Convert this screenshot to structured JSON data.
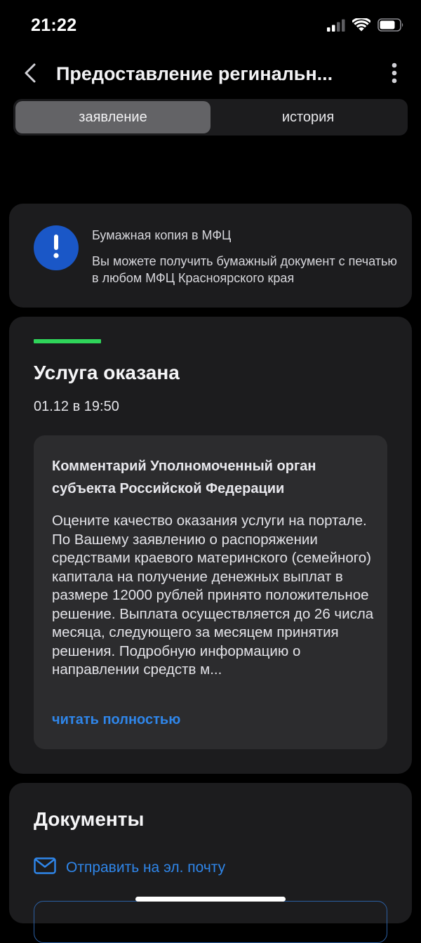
{
  "status_bar": {
    "time": "21:22"
  },
  "nav": {
    "title": "Предоставление регинальн...",
    "back_icon": "chevron-left-icon",
    "more_icon": "vertical-dots-icon"
  },
  "tabs": [
    {
      "label": "заявление",
      "active": true
    },
    {
      "label": "история",
      "active": false
    }
  ],
  "info_card": {
    "icon": "exclamation-icon",
    "title": "Бумажная копия в МФЦ",
    "text": "Вы можете получить бумажный документ с печатью в любом МФЦ Красноярского края",
    "icon_color": "#1a57c7"
  },
  "status_card": {
    "status_color": "#2fd45a",
    "title": "Услуга оказана",
    "date": "01.12 в 19:50",
    "comment": {
      "title": "Комментарий Уполномоченный орган субъекта Российской Федерации",
      "body": "Оцените качество оказания услуги на портале. По Вашему заявлению о распоряжении средствами краевого материнского (семейного) капитала на получение денежных выплат в размере 12000 рублей принято положительное решение. Выплата осуществляется до 26 числа месяца, следующего за месяцем принятия решения. Подробную информацию о направлении средств м...",
      "read_more": "читать полностью"
    }
  },
  "documents": {
    "title": "Документы",
    "email_label": "Отправить на эл. почту",
    "email_icon": "envelope-icon"
  },
  "colors": {
    "background": "#000000",
    "card": "#1c1c1e",
    "accent_blue": "#2f86ea"
  }
}
